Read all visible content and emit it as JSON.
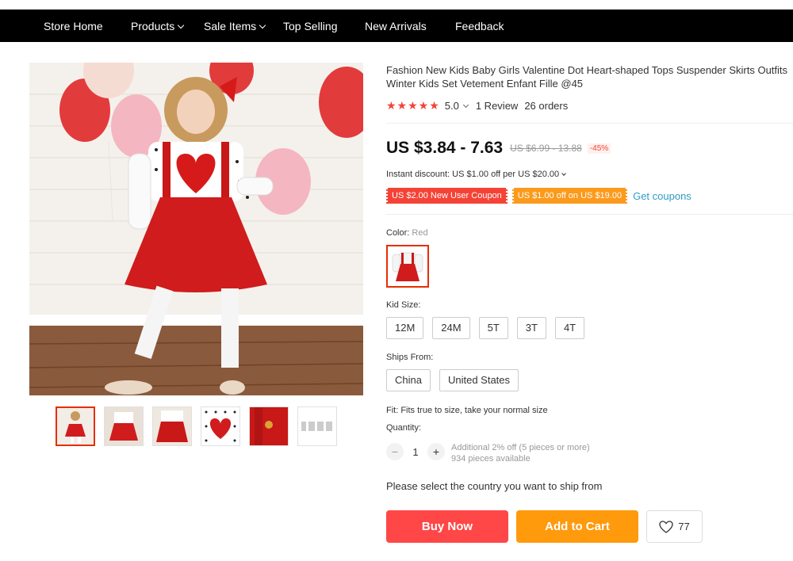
{
  "nav": {
    "items": [
      {
        "label": "Store Home",
        "dropdown": false
      },
      {
        "label": "Products",
        "dropdown": true
      },
      {
        "label": "Sale Items",
        "dropdown": true
      },
      {
        "label": "Top Selling",
        "dropdown": false
      },
      {
        "label": "New Arrivals",
        "dropdown": false
      },
      {
        "label": "Feedback",
        "dropdown": false
      }
    ]
  },
  "gallery": {
    "thumbnail_count": 6,
    "selected_thumbnail": 1
  },
  "product": {
    "title": "Fashion New Kids Baby Girls Valentine Dot Heart-shaped Tops Suspender Skirts Outfits Winter Kids Set Vetement Enfant Fille @45",
    "stars": "★★★★★",
    "rating": "5.0",
    "reviews": "1 Review",
    "orders": "26 orders",
    "price": "US $3.84 - 7.63",
    "original_price": "US $6.99 - 13.88",
    "discount": "-45%",
    "instant_discount": "Instant discount: US $1.00 off per US $20.00",
    "coupons": [
      "US $2.00 New User Coupon",
      "US $1.00 off on US $19.00"
    ],
    "get_coupons": "Get coupons"
  },
  "options": {
    "color_label": "Color:",
    "color_value": "Red",
    "size_label": "Kid Size:",
    "sizes": [
      "12M",
      "24M",
      "5T",
      "3T",
      "4T"
    ],
    "ships_label": "Ships From:",
    "ships": [
      "China",
      "United States"
    ],
    "fit": "Fit: Fits true to size, take your normal size"
  },
  "quantity": {
    "label": "Quantity:",
    "minus": "−",
    "value": "1",
    "plus": "+",
    "note_line1": "Additional 2% off (5 pieces or more)",
    "note_line2": "934 pieces available"
  },
  "ship_message": "Please select the country you want to ship from",
  "actions": {
    "buy_now": "Buy Now",
    "add_to_cart": "Add to Cart",
    "wishlist_count": "77"
  },
  "colors": {
    "nav_bg": "#000000",
    "buy_now": "#ff4747",
    "add_to_cart": "#ff9a0d",
    "star": "#f44336",
    "coupon_red": "#f44336",
    "coupon_orange": "#fb9a1c",
    "link": "#2e9cc3",
    "selected_border": "#e62e04"
  }
}
